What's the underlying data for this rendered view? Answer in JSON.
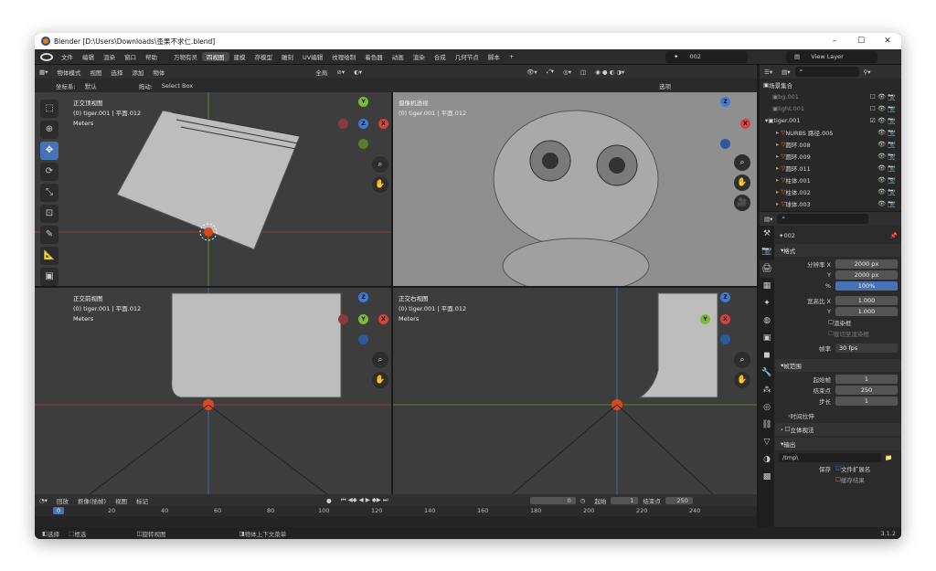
{
  "window": {
    "title": "Blender [D:\\Users\\Downloads\\歪果不求仁.blend]",
    "minimize": "–",
    "maximize": "☐",
    "close": "✕"
  },
  "menu": [
    "文件",
    "编辑",
    "渲染",
    "窗口",
    "帮助"
  ],
  "workspaces": [
    "万物有灵",
    "四视图",
    "建模",
    "存模型",
    "雕刻",
    "UV编辑",
    "纹理绘制",
    "着色器",
    "动画",
    "渲染",
    "合成",
    "几何节点",
    "脚本"
  ],
  "workspace_add": "+",
  "scene_name": "002",
  "view_layer": "View Layer",
  "viewport_header": {
    "mode": "物体模式",
    "items": [
      "视图",
      "选择",
      "添加",
      "物体"
    ],
    "transform": "全局"
  },
  "tool_settings": {
    "coord_label": "坐标系:",
    "coord_value": "默认",
    "drag_label": "拖动:",
    "drag_value": "Select Box",
    "options": "选项"
  },
  "viewports": [
    {
      "name": "正交顶视图",
      "sub": "(0) tiger.001 | 平面.012",
      "units": "Meters"
    },
    {
      "name": "摄像机透视",
      "sub": "(0) tiger.001 | 平面.012",
      "units": ""
    },
    {
      "name": "正交前视图",
      "sub": "(0) tiger.001 | 平面.012",
      "units": "Meters"
    },
    {
      "name": "正交右视图",
      "sub": "(0) tiger.001 | 平面.012",
      "units": "Meters"
    }
  ],
  "gizmo": {
    "x": "X",
    "y": "Y",
    "z": "Z"
  },
  "outliner": {
    "root": "场景集合",
    "items": [
      {
        "label": "bg.001",
        "muted": true
      },
      {
        "label": "light.001",
        "muted": true
      },
      {
        "label": "tiger.001",
        "muted": false
      },
      {
        "label": "NURBS 路径.005",
        "muted": false
      },
      {
        "label": "圆环.008",
        "muted": false
      },
      {
        "label": "圆环.009",
        "muted": false
      },
      {
        "label": "圆环.011",
        "muted": false
      },
      {
        "label": "柱体.001",
        "muted": false
      },
      {
        "label": "柱体.002",
        "muted": false
      },
      {
        "label": "球体.003",
        "muted": false
      }
    ]
  },
  "properties": {
    "scene": "002",
    "format_title": "格式",
    "res_x_label": "分辨率 X",
    "res_x": "2000 px",
    "res_y_label": "Y",
    "res_y": "2000 px",
    "pct_label": "%",
    "pct": "100%",
    "aspect_x_label": "宽高比 X",
    "aspect_x": "1.000",
    "aspect_y_label": "Y",
    "aspect_y": "1.000",
    "render_region": "渲染框",
    "crop": "裁切至渲染框",
    "fps_label": "帧率",
    "fps": "30 fps",
    "frame_title": "帧范围",
    "start_label": "起始帧",
    "start": "1",
    "end_label": "结束点",
    "end": "250",
    "step_label": "步长",
    "step": "1",
    "time_stretch": "时间拉伸",
    "stereo": "立体视法",
    "output_title": "输出",
    "output_path": "/tmp\\",
    "save_label": "保存",
    "file_ext": "文件扩展名",
    "cache": "缓存结果"
  },
  "timeline": {
    "menus": [
      "回放",
      "抠像(插帧)",
      "视图",
      "标记"
    ],
    "current": "0",
    "start_label": "起始",
    "start": "1",
    "end_label": "结束点",
    "end": "250",
    "ruler": [
      "0",
      "20",
      "40",
      "60",
      "80",
      "100",
      "120",
      "140",
      "160",
      "180",
      "200",
      "220",
      "240"
    ]
  },
  "status": {
    "select": "选择",
    "box": "框选",
    "rotate": "旋转视图",
    "context": "物体上下文菜单",
    "version": "3.1.2"
  }
}
